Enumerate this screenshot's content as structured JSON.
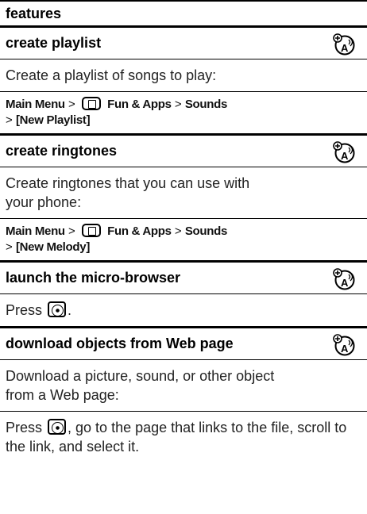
{
  "header": {
    "title": "features"
  },
  "features": [
    {
      "title": "create playlist",
      "description": "Create a playlist of songs to play:",
      "path_line1": [
        "Main Menu",
        ">",
        "Fun & Apps",
        ">",
        "Sounds"
      ],
      "path_line2": [
        ">",
        "[New Playlist]"
      ]
    },
    {
      "title": "create ringtones",
      "description": "Create ringtones that you can use with your phone:",
      "path_line1": [
        "Main Menu",
        ">",
        "Fun & Apps",
        ">",
        "Sounds"
      ],
      "path_line2": [
        ">",
        "[New Melody]"
      ]
    },
    {
      "title": "launch the micro-browser",
      "description_pre": "Press",
      "description_post": "."
    },
    {
      "title": "download objects from Web page",
      "description": "Download a picture, sound, or other object from a Web page:",
      "instr_pre": "Press",
      "instr_post": ", go to the page that links to the file, scroll to the link, and select it."
    }
  ],
  "icons": {
    "network_feature": "network-dependent-feature-icon",
    "menu_key": "fun-and-apps-menu-icon",
    "nav_key": "browser-key-icon"
  }
}
